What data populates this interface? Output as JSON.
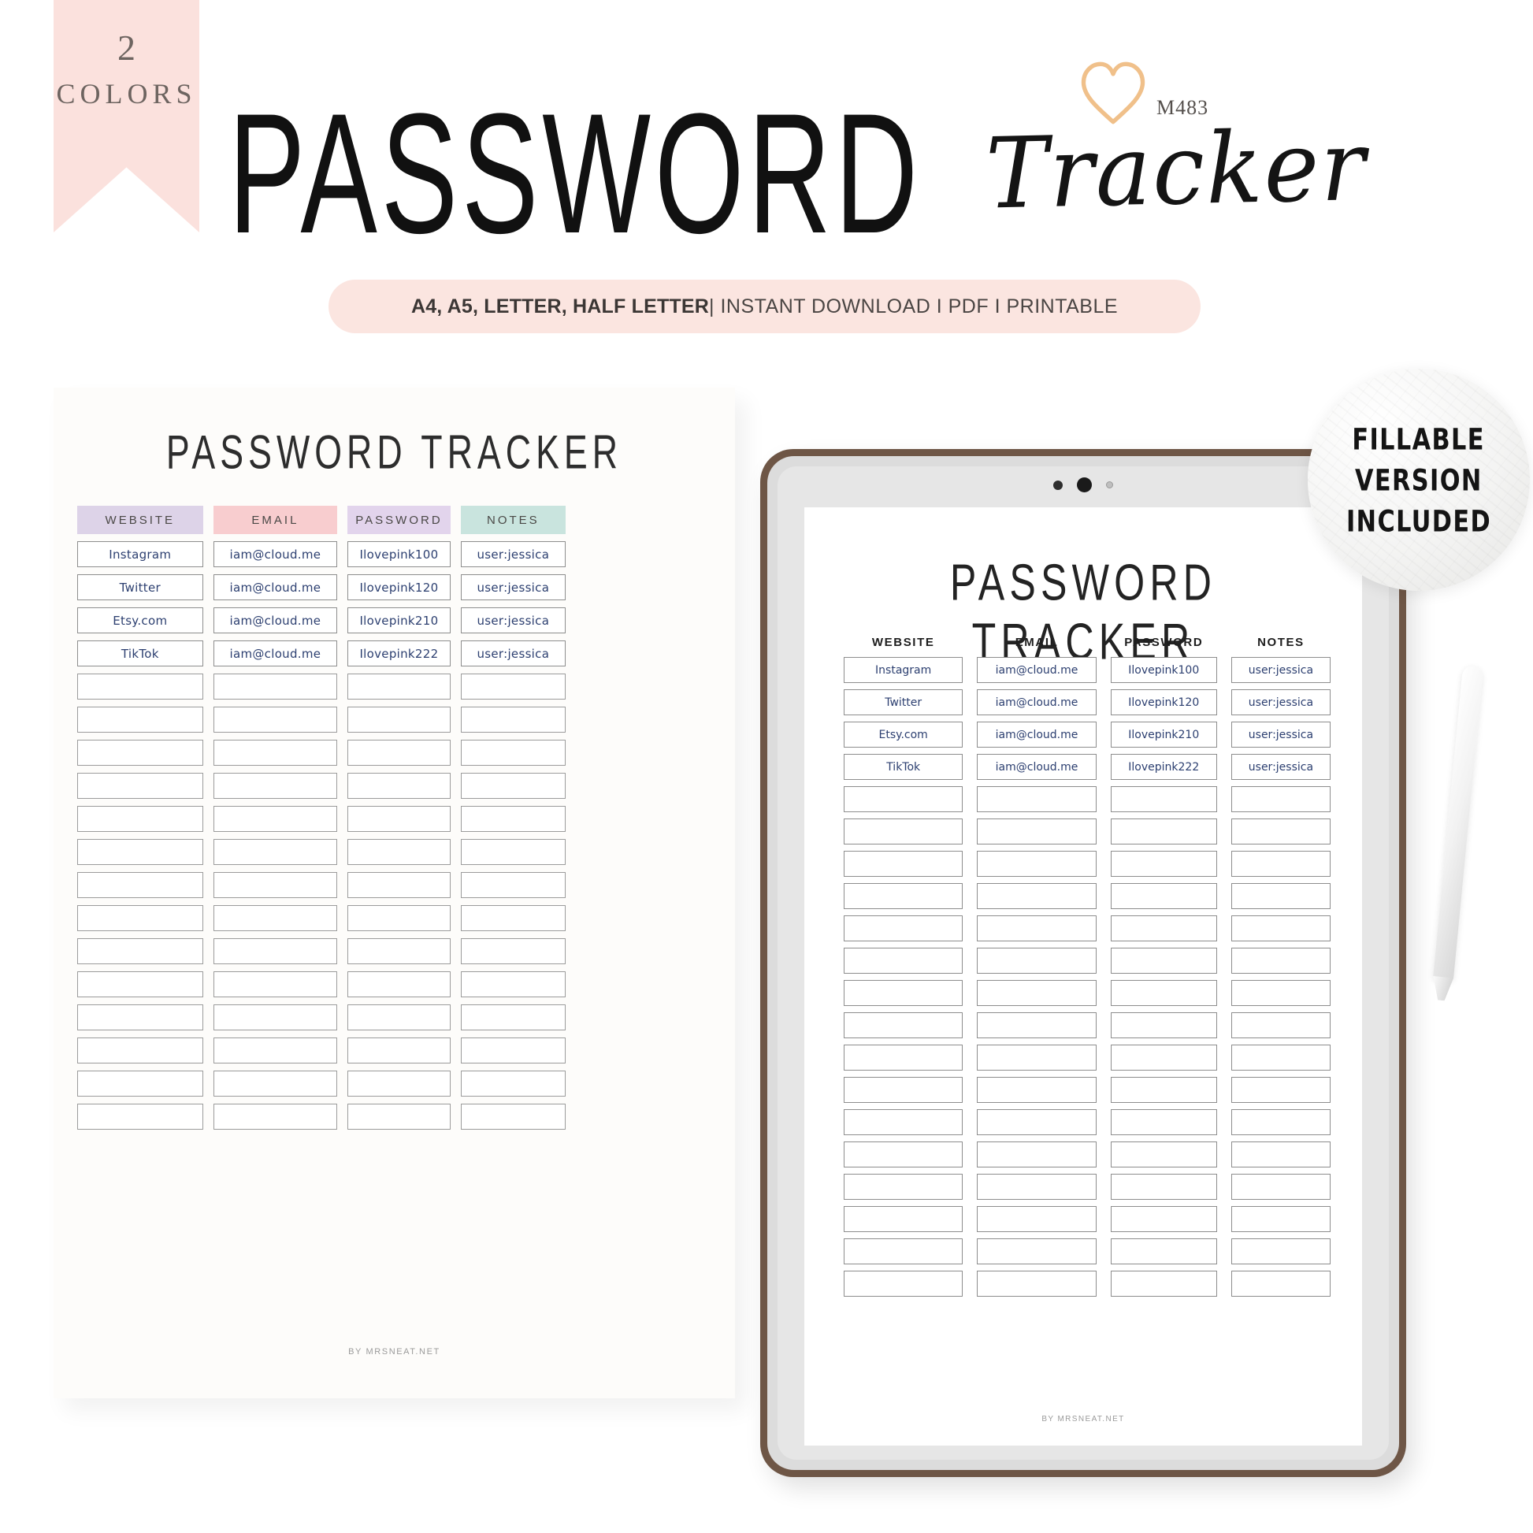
{
  "ribbon": {
    "number": "2",
    "word": "COLORS"
  },
  "header": {
    "title_main": "PASSWORD",
    "title_script": "Tracker",
    "sku": "M483",
    "heart_icon": "heart-icon",
    "heart_color": "#f0c08a"
  },
  "format_bar": {
    "bold_part": "A4, A5, LETTER, HALF LETTER",
    "rest_part": "| INSTANT DOWNLOAD I PDF I PRINTABLE",
    "background": "#fbe5e0"
  },
  "badge": {
    "line1": "FILLABLE",
    "line2": "VERSION",
    "line3": "INCLUDED"
  },
  "printable": {
    "title": "PASSWORD TRACKER",
    "footer": "BY MRSNEAT.NET",
    "columns": [
      {
        "label": "WEBSITE",
        "color": "#ddd3e8"
      },
      {
        "label": "EMAIL",
        "color": "#f8cdcf"
      },
      {
        "label": "PASSWORD",
        "color": "#e2d4ec"
      },
      {
        "label": "NOTES",
        "color": "#c9e4de"
      }
    ],
    "rows": [
      {
        "website": "Instagram",
        "email": "iam@cloud.me",
        "password": "Ilovepink100",
        "notes": "user:jessica"
      },
      {
        "website": "Twitter",
        "email": "iam@cloud.me",
        "password": "Ilovepink120",
        "notes": "user:jessica"
      },
      {
        "website": "Etsy.com",
        "email": "iam@cloud.me",
        "password": "Ilovepink210",
        "notes": "user:jessica"
      },
      {
        "website": "TikTok",
        "email": "iam@cloud.me",
        "password": "Ilovepink222",
        "notes": "user:jessica"
      }
    ],
    "empty_row_count": 14,
    "text_color": "#2c3f70"
  },
  "tablet": {
    "title": "PASSWORD TRACKER",
    "footer": "BY MRSNEAT.NET",
    "frame_color": "#6e5646",
    "columns": [
      "WEBSITE",
      "EMAIL",
      "PASSWORD",
      "NOTES"
    ],
    "rows": [
      {
        "website": "Instagram",
        "email": "iam@cloud.me",
        "password": "Ilovepink100",
        "notes": "user:jessica"
      },
      {
        "website": "Twitter",
        "email": "iam@cloud.me",
        "password": "Ilovepink120",
        "notes": "user:jessica"
      },
      {
        "website": "Etsy.com",
        "email": "iam@cloud.me",
        "password": "Ilovepink210",
        "notes": "user:jessica"
      },
      {
        "website": "TikTok",
        "email": "iam@cloud.me",
        "password": "Ilovepink222",
        "notes": "user:jessica"
      }
    ],
    "empty_row_count": 16,
    "camera_icons": [
      "camera-dot-small",
      "camera-lens",
      "sensor-dot"
    ]
  },
  "stylus": {
    "icon": "stylus-pencil"
  }
}
